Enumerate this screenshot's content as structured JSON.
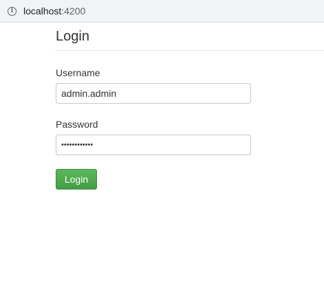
{
  "browser": {
    "url_host": "localhost",
    "url_port": ":4200",
    "info_icon": "info-icon"
  },
  "page": {
    "title": "Login"
  },
  "form": {
    "username_label": "Username",
    "username_value": "admin.admin",
    "password_label": "Password",
    "password_value": "adminpass123",
    "submit_label": "Login"
  },
  "colors": {
    "button_green": "#5cb85c",
    "button_border": "#3d8b3d",
    "address_bar_bg": "#f1f3f4"
  }
}
